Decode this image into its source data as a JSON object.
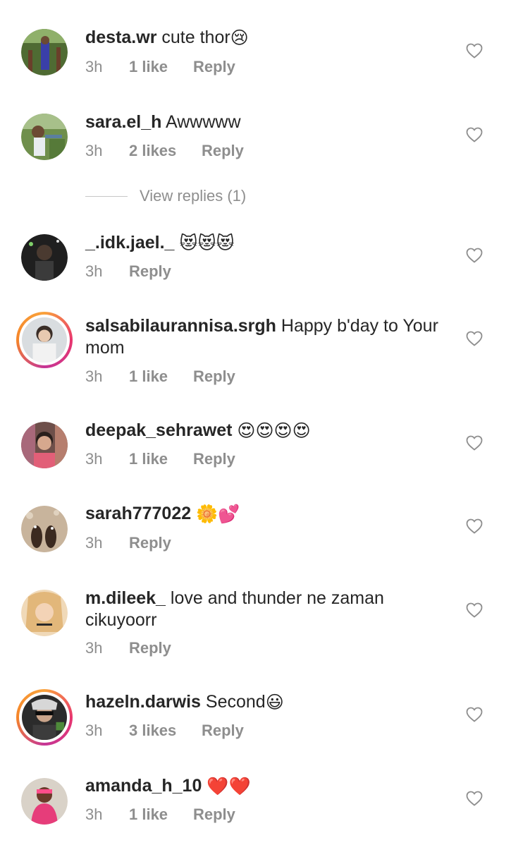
{
  "comments": [
    {
      "username": "desta.wr",
      "text": "cute thor",
      "emojis": [
        "😢"
      ],
      "time": "3h",
      "likes": "1 like",
      "reply": "Reply",
      "avatar_color": "#5a7a3e"
    },
    {
      "username": "sara.el_h",
      "text": "Awwwww",
      "emojis": [],
      "time": "3h",
      "likes": "2 likes",
      "reply": "Reply",
      "avatar_color": "#8aa06a"
    },
    {
      "username": "_.idk.jael._",
      "text": "",
      "emojis": [
        "😻",
        "😻",
        "😻"
      ],
      "time": "3h",
      "likes": "",
      "reply": "Reply",
      "avatar_color": "#2e2e2e"
    },
    {
      "username": "salsabilaurannisa.srgh",
      "text": "Happy b'day to Your mom",
      "emojis": [],
      "time": "3h",
      "likes": "1 like",
      "reply": "Reply",
      "avatar_color": "#cfd4d8"
    },
    {
      "username": "deepak_sehrawet",
      "text": "",
      "emojis": [
        "😍",
        "😍",
        "😍",
        "😍"
      ],
      "time": "3h",
      "likes": "1 like",
      "reply": "Reply",
      "avatar_color": "#c98d86"
    },
    {
      "username": "sarah777022",
      "text": "",
      "emojis": [
        "🌼",
        "💕"
      ],
      "time": "3h",
      "likes": "",
      "reply": "Reply",
      "avatar_color": "#b59e86"
    },
    {
      "username": "m.dileek_",
      "text": "love and thunder ne zaman cikuyoorr",
      "emojis": [],
      "time": "3h",
      "likes": "",
      "reply": "Reply",
      "avatar_color": "#e8c79a"
    },
    {
      "username": "hazeln.darwis",
      "text": "Second",
      "emojis": [
        "😃"
      ],
      "time": "3h",
      "likes": "3 likes",
      "reply": "Reply",
      "avatar_color": "#3a3a3a"
    },
    {
      "username": "amanda_h_10",
      "text": "",
      "emojis": [
        "❤️",
        "❤️"
      ],
      "time": "3h",
      "likes": "1 like",
      "reply": "Reply",
      "avatar_color": "#c2557a"
    }
  ],
  "view_replies": {
    "label": "View replies (1)"
  },
  "colors": {
    "text": "#262626",
    "muted": "#8e8e8e",
    "story_ring": "#e8356e"
  }
}
